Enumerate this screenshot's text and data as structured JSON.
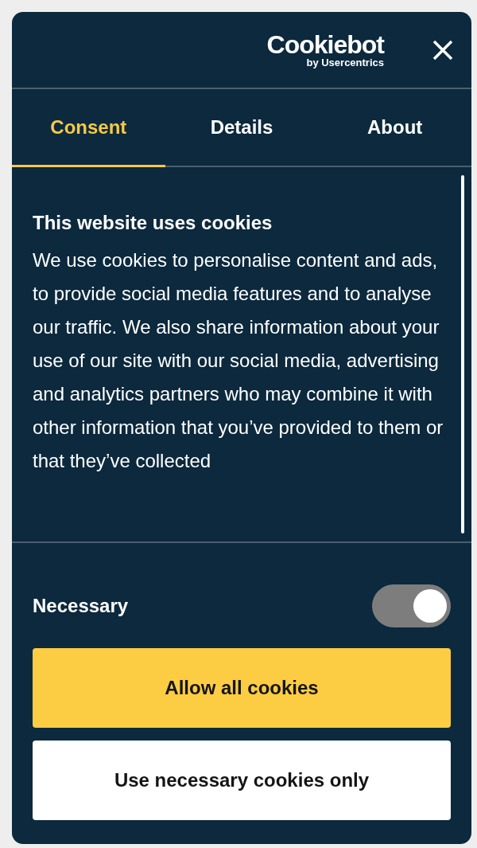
{
  "header": {
    "logo_text": "Cookiebot",
    "logo_subtext": "by Usercentrics"
  },
  "tabs": [
    {
      "label": "Consent",
      "selected": true
    },
    {
      "label": "Details",
      "selected": false
    },
    {
      "label": "About",
      "selected": false
    }
  ],
  "content": {
    "title": "This website uses cookies",
    "body": "We use cookies to personalise content and ads, to provide social media features and to analyse our traffic. We also share information about your use of our site with our social media, advertising and analytics partners who may combine it with other information that you’ve provided to them or that they’ve collected"
  },
  "toggles": [
    {
      "label": "Necessary",
      "checked": true,
      "disabled": true
    }
  ],
  "buttons": [
    {
      "label": "Allow all cookies",
      "kind": "primary"
    },
    {
      "label": "Use necessary cookies only",
      "kind": "secondary"
    }
  ]
}
